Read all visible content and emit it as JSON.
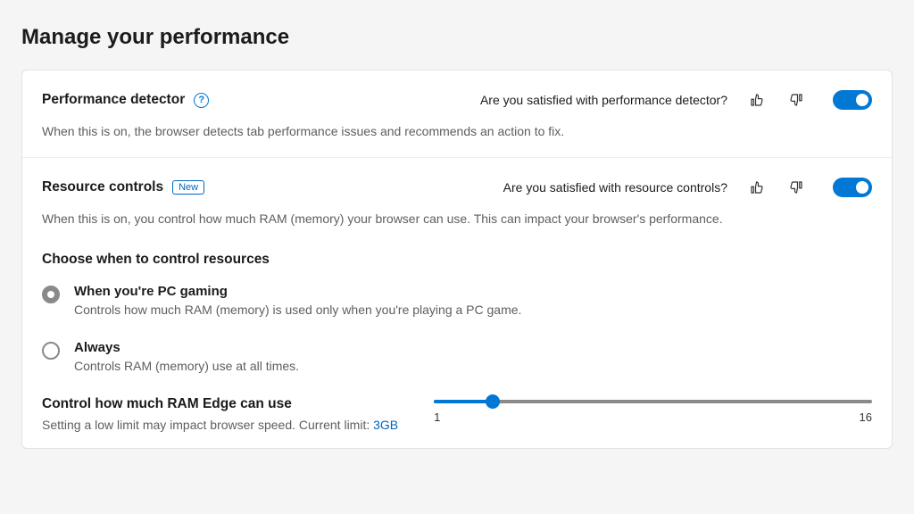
{
  "page": {
    "title": "Manage your performance"
  },
  "performance_detector": {
    "title": "Performance detector",
    "feedback_question": "Are you satisfied with performance detector?",
    "desc": "When this is on, the browser detects tab performance issues and recommends an action to fix.",
    "toggle_on": true
  },
  "resource_controls": {
    "title": "Resource controls",
    "badge": "New",
    "feedback_question": "Are you satisfied with resource controls?",
    "desc": "When this is on, you control how much RAM (memory) your browser can use. This can impact your browser's performance.",
    "toggle_on": true,
    "choose_heading": "Choose when to control resources",
    "options": [
      {
        "label": "When you're PC gaming",
        "desc": "Controls how much RAM (memory) is used only when you're playing a PC game.",
        "selected": true
      },
      {
        "label": "Always",
        "desc": "Controls RAM (memory) use at all times.",
        "selected": false
      }
    ],
    "ram_slider": {
      "title": "Control how much RAM Edge can use",
      "desc_prefix": "Setting a low limit may impact browser speed. Current limit: ",
      "current_limit_label": "3GB",
      "min": 1,
      "max": 16,
      "value": 3,
      "min_label": "1",
      "max_label": "16"
    }
  }
}
